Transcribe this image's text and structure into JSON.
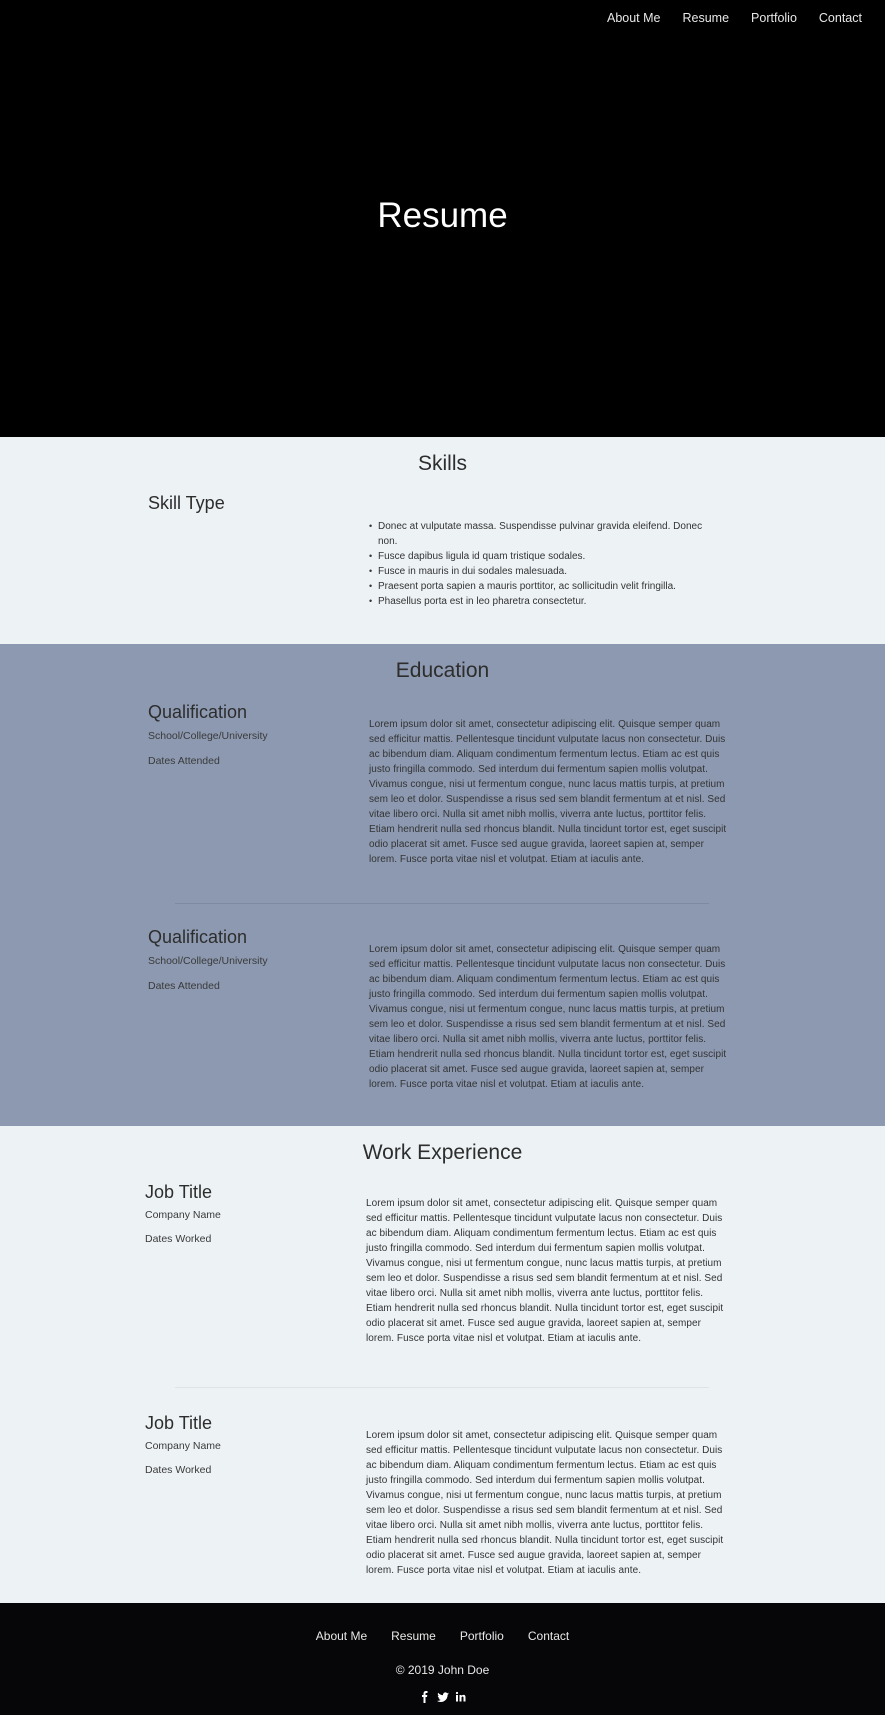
{
  "nav": {
    "about": "About Me",
    "resume": "Resume",
    "portfolio": "Portfolio",
    "contact": "Contact"
  },
  "hero": {
    "title": "Resume"
  },
  "skills": {
    "title": "Skills",
    "type": "Skill Type",
    "items": [
      "Donec at vulputate massa. Suspendisse pulvinar gravida eleifend. Donec non.",
      "Fusce dapibus ligula id quam tristique sodales.",
      "Fusce in mauris in dui sodales malesuada.",
      "Praesent porta sapien a mauris porttitor, ac sollicitudin velit fringilla.",
      "Phasellus porta est in leo pharetra consectetur."
    ]
  },
  "education": {
    "title": "Education",
    "entries": [
      {
        "heading": "Qualification",
        "school": "School/College/University",
        "dates": "Dates Attended",
        "text": "Lorem ipsum dolor sit amet, consectetur adipiscing elit. Quisque semper quam sed efficitur mattis. Pellentesque tincidunt vulputate lacus non consectetur. Duis ac bibendum diam. Aliquam condimentum fermentum lectus. Etiam ac est quis justo fringilla commodo. Sed interdum dui fermentum sapien mollis volutpat. Vivamus congue, nisi ut fermentum congue, nunc lacus mattis turpis, at pretium sem leo et dolor. Suspendisse a risus sed sem blandit fermentum at et nisl. Sed vitae libero orci. Nulla sit amet nibh mollis, viverra ante luctus, porttitor felis. Etiam hendrerit nulla sed rhoncus blandit. Nulla tincidunt tortor est, eget suscipit odio placerat sit amet. Fusce sed augue gravida, laoreet sapien at, semper lorem. Fusce porta vitae nisl et volutpat. Etiam at iaculis ante."
      },
      {
        "heading": "Qualification",
        "school": "School/College/University",
        "dates": "Dates Attended",
        "text": "Lorem ipsum dolor sit amet, consectetur adipiscing elit. Quisque semper quam sed efficitur mattis. Pellentesque tincidunt vulputate lacus non consectetur. Duis ac bibendum diam. Aliquam condimentum fermentum lectus. Etiam ac est quis justo fringilla commodo. Sed interdum dui fermentum sapien mollis volutpat. Vivamus congue, nisi ut fermentum congue, nunc lacus mattis turpis, at pretium sem leo et dolor. Suspendisse a risus sed sem blandit fermentum at et nisl. Sed vitae libero orci. Nulla sit amet nibh mollis, viverra ante luctus, porttitor felis. Etiam hendrerit nulla sed rhoncus blandit. Nulla tincidunt tortor est, eget suscipit odio placerat sit amet. Fusce sed augue gravida, laoreet sapien at, semper lorem. Fusce porta vitae nisl et volutpat. Etiam at iaculis ante."
      }
    ]
  },
  "work": {
    "title": "Work Experience",
    "entries": [
      {
        "heading": "Job Title",
        "company": "Company Name",
        "dates": "Dates Worked",
        "text": "Lorem ipsum dolor sit amet, consectetur adipiscing elit. Quisque semper quam sed efficitur mattis. Pellentesque tincidunt vulputate lacus non consectetur. Duis ac bibendum diam. Aliquam condimentum fermentum lectus. Etiam ac est quis justo fringilla commodo. Sed interdum dui fermentum sapien mollis volutpat. Vivamus congue, nisi ut fermentum congue, nunc lacus mattis turpis, at pretium sem leo et dolor. Suspendisse a risus sed sem blandit fermentum at et nisl. Sed vitae libero orci. Nulla sit amet nibh mollis, viverra ante luctus, porttitor felis. Etiam hendrerit nulla sed rhoncus blandit. Nulla tincidunt tortor est, eget suscipit odio placerat sit amet. Fusce sed augue gravida, laoreet sapien at, semper lorem. Fusce porta vitae nisl et volutpat. Etiam at iaculis ante."
      },
      {
        "heading": "Job Title",
        "company": "Company Name",
        "dates": "Dates Worked",
        "text": "Lorem ipsum dolor sit amet, consectetur adipiscing elit. Quisque semper quam sed efficitur mattis. Pellentesque tincidunt vulputate lacus non consectetur. Duis ac bibendum diam. Aliquam condimentum fermentum lectus. Etiam ac est quis justo fringilla commodo. Sed interdum dui fermentum sapien mollis volutpat. Vivamus congue, nisi ut fermentum congue, nunc lacus mattis turpis, at pretium sem leo et dolor. Suspendisse a risus sed sem blandit fermentum at et nisl. Sed vitae libero orci. Nulla sit amet nibh mollis, viverra ante luctus, porttitor felis. Etiam hendrerit nulla sed rhoncus blandit. Nulla tincidunt tortor est, eget suscipit odio placerat sit amet. Fusce sed augue gravida, laoreet sapien at, semper lorem. Fusce porta vitae nisl et volutpat. Etiam at iaculis ante."
      }
    ]
  },
  "footer": {
    "copyright": "© 2019 John Doe",
    "social": [
      "facebook-icon",
      "twitter-icon",
      "linkedin-icon"
    ]
  },
  "colors": {
    "hero_bg": "#000000",
    "light_bg": "#edf2f5",
    "education_bg": "#8c99b0",
    "footer_bg": "#060608"
  }
}
